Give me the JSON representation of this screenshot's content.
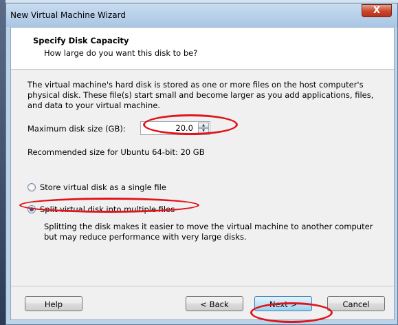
{
  "window": {
    "title": "New Virtual Machine Wizard",
    "close_label": "X"
  },
  "header": {
    "title": "Specify Disk Capacity",
    "subtitle": "How large do you want this disk to be?"
  },
  "main": {
    "description": "The virtual machine's hard disk is stored as one or more files on the host computer's physical disk. These file(s) start small and become larger as you add applications, files, and data to your virtual machine.",
    "max_disk_label": "Maximum disk size (GB):",
    "max_disk_value": "20.0",
    "recommended": "Recommended size for Ubuntu 64-bit: 20 GB",
    "radio_single": {
      "label": "Store virtual disk as a single file",
      "selected": false
    },
    "radio_split": {
      "label": "Split virtual disk into multiple files",
      "selected": true
    },
    "split_description": "Splitting the disk makes it easier to move the virtual machine to another computer but may reduce performance with very large disks."
  },
  "footer": {
    "help_label": "Help",
    "back_label": "< Back",
    "next_label": "Next >",
    "cancel_label": "Cancel"
  },
  "annotation_color": "#e0141c"
}
